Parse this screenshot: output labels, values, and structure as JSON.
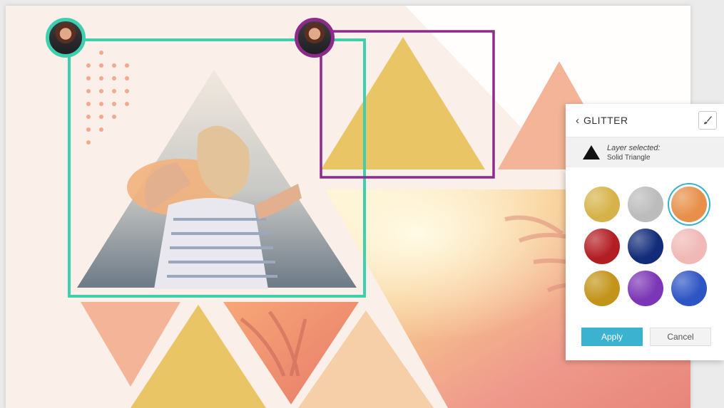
{
  "panel": {
    "title": "GLITTER",
    "back_icon": "chevron-left-icon",
    "brush_icon": "paintbrush-icon",
    "layer_label": "Layer selected:",
    "layer_name": "Solid Triangle",
    "apply_label": "Apply",
    "cancel_label": "Cancel",
    "swatches": [
      {
        "name": "gold",
        "color": "#d6b34a",
        "selected": false
      },
      {
        "name": "silver",
        "color": "#bcbcbc",
        "selected": false
      },
      {
        "name": "orange",
        "color": "#e8904a",
        "selected": true
      },
      {
        "name": "red",
        "color": "#b31e24",
        "selected": false
      },
      {
        "name": "navy",
        "color": "#132c7a",
        "selected": false
      },
      {
        "name": "pink",
        "color": "#f0b9b6",
        "selected": false
      },
      {
        "name": "dark-gold",
        "color": "#c29419",
        "selected": false
      },
      {
        "name": "purple",
        "color": "#7b35b6",
        "selected": false
      },
      {
        "name": "blue",
        "color": "#2e55c4",
        "selected": false
      }
    ]
  },
  "colors": {
    "collaborator_1": "#3ecfae",
    "collaborator_2": "#8e2a8a",
    "accent": "#3bb3d0"
  }
}
